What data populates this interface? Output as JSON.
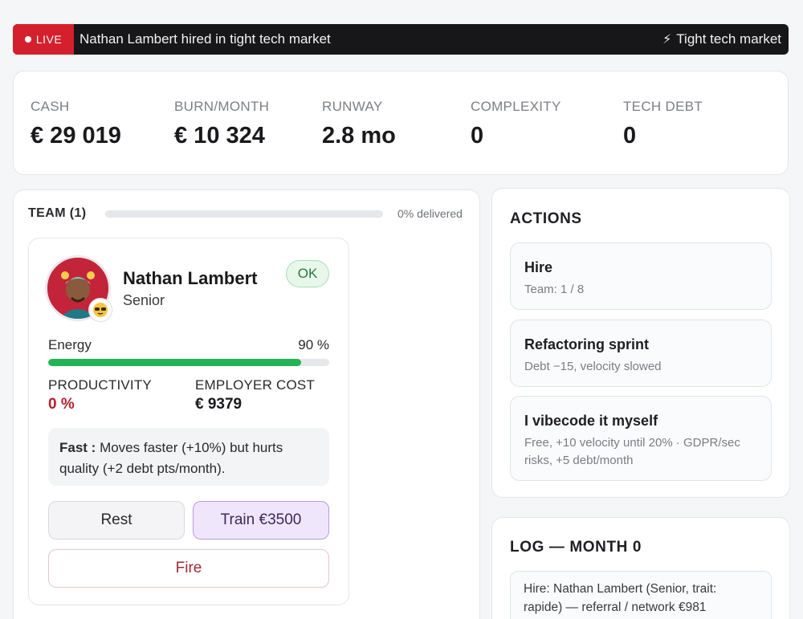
{
  "ticker": {
    "live_label": "LIVE",
    "message": "Nathan Lambert hired in tight tech market",
    "market_condition": "Tight tech market",
    "condition_icon": "lightning-bolt-icon"
  },
  "stats": {
    "cash": {
      "label": "CASH",
      "value": "€ 29 019"
    },
    "burn": {
      "label": "BURN/MONTH",
      "value": "€ 10 324"
    },
    "runway": {
      "label": "RUNWAY",
      "value": "2.8 mo"
    },
    "complexity": {
      "label": "COMPLEXITY",
      "value": "0"
    },
    "tech_debt": {
      "label": "TECH DEBT",
      "value": "0"
    }
  },
  "team": {
    "header": "TEAM (1)",
    "delivered_label": "0% delivered",
    "delivered_pct": 0,
    "members": [
      {
        "name": "Nathan Lambert",
        "level": "Senior",
        "status": "OK",
        "energy_label": "Energy",
        "energy_value": "90 %",
        "energy_pct": 90,
        "productivity_label": "PRODUCTIVITY",
        "productivity_value": "0 %",
        "cost_label": "EMPLOYER COST",
        "cost_value": "€ 9379",
        "trait_name": "Fast :",
        "trait_desc": " Moves faster (+10%) but hurts quality (+2 debt pts/month).",
        "rest_label": "Rest",
        "train_label": "Train €3500",
        "fire_label": "Fire",
        "colors": {
          "productivity": "#b3202e",
          "status_bg": "#e7f7ea",
          "energy": "#22b455"
        }
      }
    ]
  },
  "actions": {
    "title": "ACTIONS",
    "items": [
      {
        "title": "Hire",
        "desc": "Team: 1 / 8"
      },
      {
        "title": "Refactoring sprint",
        "desc": "Debt −15, velocity slowed"
      },
      {
        "title": "I vibecode it myself",
        "desc": "Free, +10 velocity until 20% · GDPR/sec risks, +5 debt/month"
      }
    ]
  },
  "log": {
    "title": "LOG — MONTH 0",
    "entries": [
      "Hire: Nathan Lambert (Senior, trait: rapide) — referral / network €981"
    ]
  }
}
